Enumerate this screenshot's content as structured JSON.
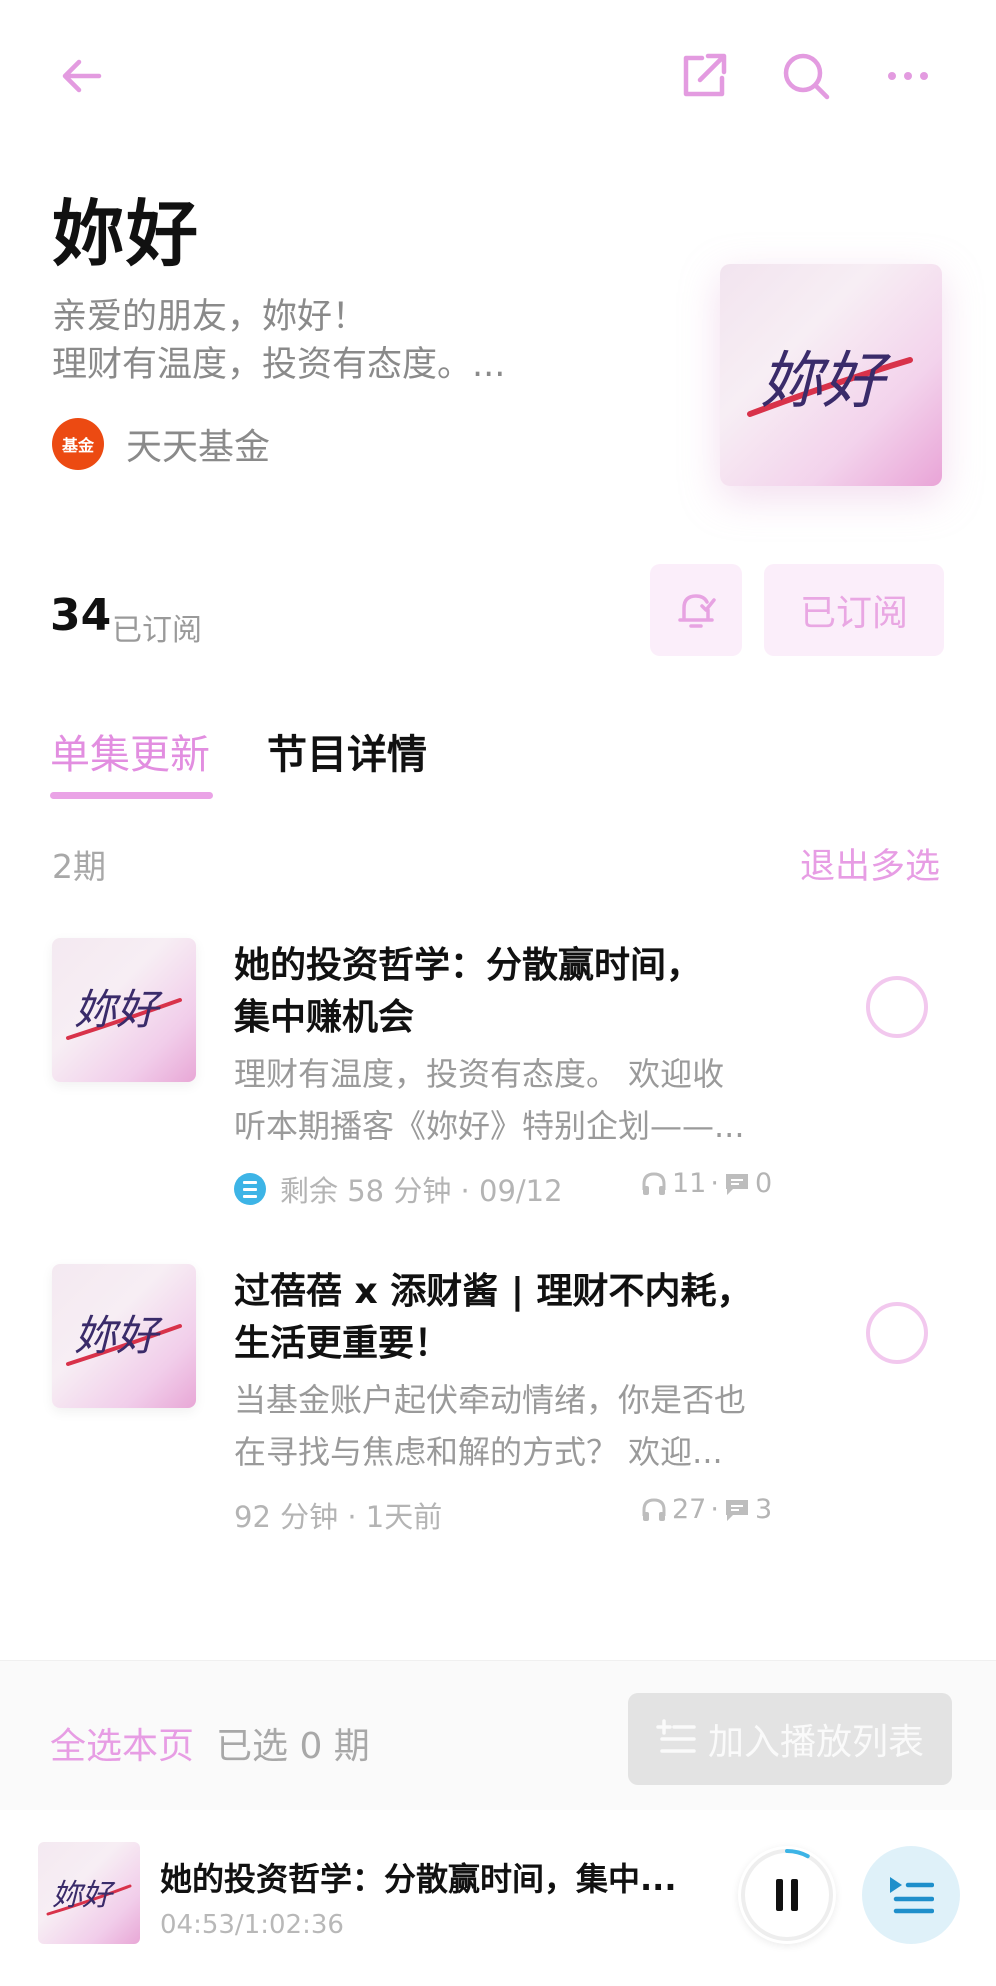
{
  "header": {
    "back_icon": "arrow-left-icon",
    "share_icon": "share-icon",
    "search_icon": "search-icon",
    "more_icon": "more-icon"
  },
  "podcast": {
    "title": "妳好",
    "description_line1": "亲爱的朋友，妳好！",
    "description_line2": "理财有温度，投资有态度。...",
    "publisher": "天天基金",
    "publisher_logo_text": "基金",
    "cover_text": "妳好"
  },
  "subscription": {
    "count": "34",
    "label": "已订阅",
    "button_label": "已订阅",
    "bell_icon": "bell-check-icon"
  },
  "tabs": [
    {
      "label": "单集更新",
      "active": true
    },
    {
      "label": "节目详情",
      "active": false
    }
  ],
  "list_header": {
    "count": "2期",
    "exit_multi": "退出多选"
  },
  "episodes": [
    {
      "title_line1": "她的投资哲学：分散赢时间，",
      "title_line2": "集中赚机会",
      "desc_line1": "理财有温度，投资有态度。 欢迎收",
      "desc_line2": "听本期播客《妳好》特别企划——...",
      "meta": "剩余 58 分钟 · 09/12",
      "plays": "11",
      "comments": "0",
      "cover_text": "妳好"
    },
    {
      "title_line1": "过蓓蓓 x 添财酱 | 理财不内耗，",
      "title_line2": "生活更重要！",
      "desc_line1": "当基金账户起伏牵动情绪，你是否也",
      "desc_line2": "在寻找与焦虑和解的方式？ 欢迎...",
      "meta": "92 分钟 · 1天前",
      "plays": "27",
      "comments": "3",
      "cover_text": "妳好"
    }
  ],
  "selection": {
    "select_all": "全选本页",
    "selected_count": "已选 0 期",
    "add_to_playlist": "加入播放列表"
  },
  "player": {
    "title": "她的投资哲学：分散赢时间，集中...",
    "time": "04:53/1:02:36",
    "cover_text": "妳好",
    "progress": 0.078
  },
  "colors": {
    "accent": "#e79de4",
    "accent_light": "#fbeefa",
    "info_blue": "#3db4e6"
  }
}
